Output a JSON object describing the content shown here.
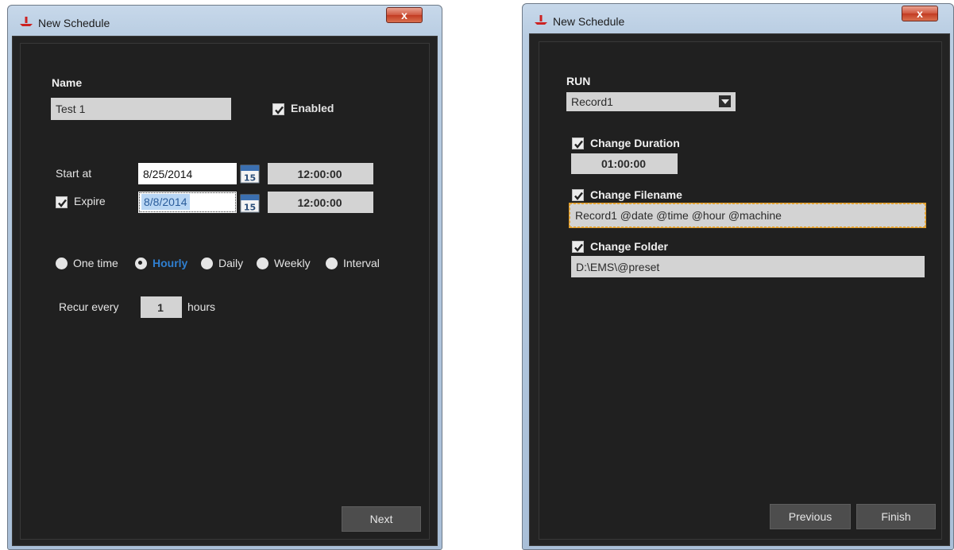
{
  "left_window": {
    "title": "New Schedule",
    "close_glyph": "x",
    "name_label": "Name",
    "name_value": "Test 1",
    "enabled_label": "Enabled",
    "enabled_checked": true,
    "start_label": "Start at",
    "start_date": "8/25/2014",
    "start_time": "12:00:00",
    "expire_label": "Expire",
    "expire_checked": true,
    "expire_date": "8/8/2014",
    "expire_time": "12:00:00",
    "calendar_day": "15",
    "recurrence": {
      "options": [
        "One time",
        "Hourly",
        "Daily",
        "Weekly",
        "Interval"
      ],
      "selected": "Hourly"
    },
    "recur_label": "Recur every",
    "recur_value": "1",
    "recur_unit": "hours",
    "next_label": "Next"
  },
  "right_window": {
    "title": "New Schedule",
    "close_glyph": "x",
    "run_label": "RUN",
    "run_value": "Record1",
    "change_duration_label": "Change Duration",
    "duration_value": "01:00:00",
    "change_filename_label": "Change Filename",
    "filename_value": "Record1 @date @time @hour @machine",
    "change_folder_label": "Change Folder",
    "folder_value": "D:\\EMS\\@preset",
    "previous_label": "Previous",
    "finish_label": "Finish"
  },
  "colors": {
    "accent": "#2f7fd0",
    "panel_bg": "#202020",
    "field_bg": "#d3d3d3",
    "focus_border": "#e3a12f"
  },
  "icons": [
    "app-icon",
    "close-icon",
    "checkmark-icon",
    "calendar-icon",
    "dropdown-arrow-icon",
    "radio-icon"
  ]
}
